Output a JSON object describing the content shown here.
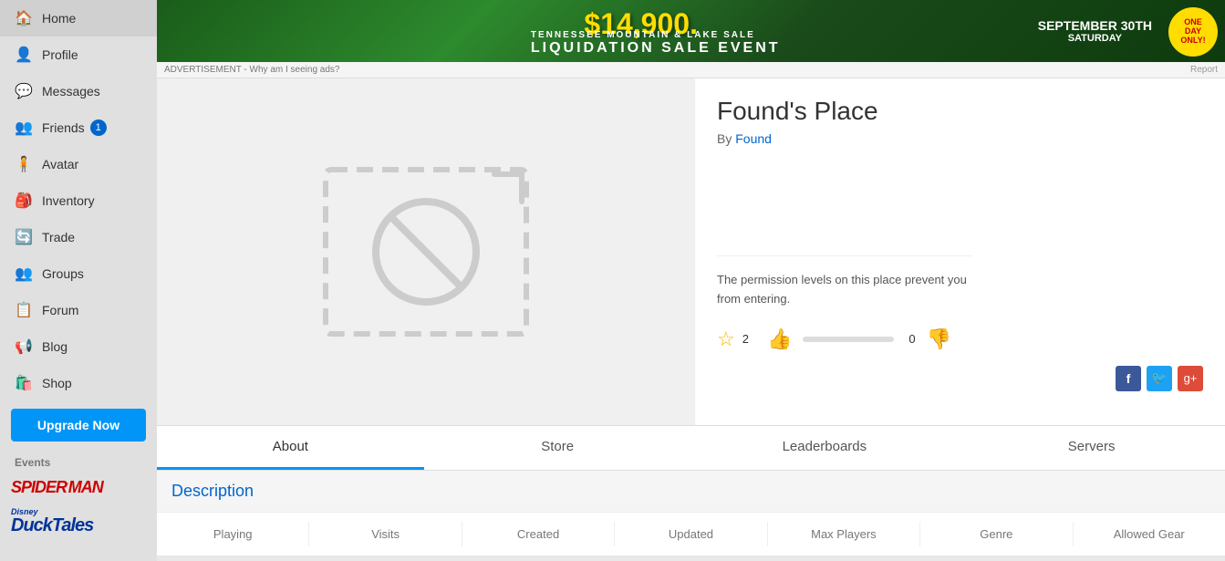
{
  "sidebar": {
    "items": [
      {
        "label": "Home",
        "icon": "🏠"
      },
      {
        "label": "Profile",
        "icon": "👤"
      },
      {
        "label": "Messages",
        "icon": "💬"
      },
      {
        "label": "Friends",
        "icon": "👥",
        "badge": "1"
      },
      {
        "label": "Avatar",
        "icon": "🧍"
      },
      {
        "label": "Inventory",
        "icon": "🎒"
      },
      {
        "label": "Trade",
        "icon": "🔄"
      },
      {
        "label": "Groups",
        "icon": "👥"
      },
      {
        "label": "Forum",
        "icon": "📋"
      },
      {
        "label": "Blog",
        "icon": "📢"
      },
      {
        "label": "Shop",
        "icon": "🛍️"
      }
    ],
    "upgrade_label": "Upgrade Now",
    "events_label": "Events"
  },
  "ad": {
    "main_text": "$14,900.",
    "sale_text": "TENNESSEE MOUNTAIN & LAKE SALE",
    "liquidation": "LIQUIDATION SALE EVENT",
    "september": "SEPTEMBER 30TH",
    "saturday": "SATURDAY",
    "oneday_line1": "ONE",
    "oneday_line2": "DAY",
    "oneday_line3": "ONLY!",
    "footer_left": "ADVERTISEMENT - Why am I seeing ads?",
    "footer_right": "Report"
  },
  "place": {
    "title": "Found's Place",
    "by_prefix": "By",
    "author": "Found",
    "permission_text": "The permission levels on this place prevent you from entering.",
    "star_count": "2",
    "thumb_up_count": "0",
    "thumb_down_count": "0"
  },
  "tabs": [
    {
      "label": "About",
      "active": true
    },
    {
      "label": "Store",
      "active": false
    },
    {
      "label": "Leaderboards",
      "active": false
    },
    {
      "label": "Servers",
      "active": false
    }
  ],
  "description": {
    "title": "Description"
  },
  "stats": {
    "columns": [
      "Playing",
      "Visits",
      "Created",
      "Updated",
      "Max Players",
      "Genre",
      "Allowed Gear"
    ]
  },
  "events": [
    {
      "name": "SPIDER-MAN",
      "type": "spiderman"
    },
    {
      "name": "DUCKTALES",
      "type": "ducktales"
    }
  ]
}
